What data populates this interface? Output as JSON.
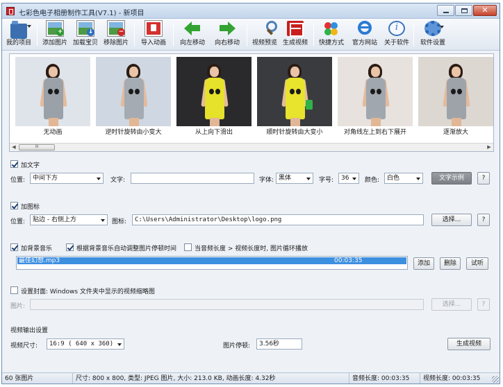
{
  "window": {
    "title": "七彩色电子相册制作工具(V7.1) - 新项目",
    "controls": [
      "minimize",
      "maximize",
      "close"
    ]
  },
  "toolbar": [
    {
      "id": "my-project",
      "label": "我的项目",
      "icon": "folder-icon"
    },
    {
      "id": "add-image",
      "label": "添加图片",
      "icon": "add-image-icon"
    },
    {
      "id": "load-saved",
      "label": "加载宝贝",
      "icon": "load-icon"
    },
    {
      "id": "remove-image",
      "label": "移除图片",
      "icon": "remove-image-icon"
    },
    {
      "id": "import-animation",
      "label": "导入动画",
      "icon": "import-icon"
    },
    {
      "id": "move-left",
      "label": "向左移动",
      "icon": "arrow-left-icon"
    },
    {
      "id": "move-right",
      "label": "向右移动",
      "icon": "arrow-right-icon"
    },
    {
      "id": "video-preview",
      "label": "视频预览",
      "icon": "magnifier-icon"
    },
    {
      "id": "generate-video",
      "label": "生成视频",
      "icon": "film-icon"
    },
    {
      "id": "shortcut",
      "label": "快捷方式",
      "icon": "shortcut-icon"
    },
    {
      "id": "website",
      "label": "官方网站",
      "icon": "browser-icon"
    },
    {
      "id": "about",
      "label": "关于软件",
      "icon": "info-icon"
    },
    {
      "id": "settings",
      "label": "软件设置",
      "icon": "gear-icon"
    }
  ],
  "thumbnails": [
    {
      "caption": "无动画",
      "scene": "gray-dress-white-room",
      "bg": "#dfe4ea",
      "dress": "#9aa1a9"
    },
    {
      "caption": "逆时针旋转由小变大",
      "scene": "gray-dress-window",
      "bg": "#cfd8e2",
      "dress": "#a4abb3"
    },
    {
      "caption": "从上向下滑出",
      "scene": "yellow-dress-car",
      "bg": "#2a2a2c",
      "dress": "#e6e12a"
    },
    {
      "caption": "顺时针旋转由大变小",
      "scene": "yellow-dress-car-bag",
      "bg": "#3a3b3f",
      "dress": "#e8e32c"
    },
    {
      "caption": "对角线左上到右下展开",
      "scene": "gray-dress-room",
      "bg": "#e7e2dd",
      "dress": "#a1a7ae"
    },
    {
      "caption": "逐渐放大",
      "scene": "gray-dress-closeup",
      "bg": "#ddd7d2",
      "dress": "#9ea3aa"
    }
  ],
  "text_section": {
    "enable_label": "加文字",
    "enabled": true,
    "position_label": "位置:",
    "position_value": "中间下方",
    "text_label": "文字:",
    "text_value": "",
    "font_label": "字体:",
    "font_value": "黑体",
    "size_label": "字号:",
    "size_value": "36",
    "color_label": "颜色:",
    "color_value": "白色",
    "sample_button": "文字示例",
    "help_button": "?"
  },
  "logo_section": {
    "enable_label": "加图标",
    "enabled": true,
    "position_label": "位置:",
    "position_value": "贴边 - 右侧上方",
    "icon_label": "图标:",
    "icon_path": "C:\\Users\\Administrator\\Desktop\\logo.png",
    "browse_button": "选择...",
    "help_button": "?"
  },
  "music_section": {
    "enable_label": "加背景音乐",
    "enabled": true,
    "auto_adjust_label": "根据背景音乐自动调整图片停顿时间",
    "auto_adjust": true,
    "loop_label": "当音频长度 > 视频长度时, 图片循环播放",
    "loop": false,
    "track_name": "最佳幻想.mp3",
    "track_duration": "00:03:35",
    "add_button": "添加",
    "delete_button": "删除",
    "listen_button": "试听"
  },
  "cover_section": {
    "enable_label": "设置封面: Windows 文件夹中显示的视频缩略图",
    "enabled": false,
    "image_label": "图片:",
    "image_value": "",
    "browse_button": "选择...",
    "help_button": "?"
  },
  "output_section": {
    "title": "视频输出设置",
    "size_label": "视频尺寸:",
    "size_value": "16:9 ( 640 x 360)",
    "pause_label": "图片停顿:",
    "pause_value": "3.56秒",
    "generate_button": "生成视频"
  },
  "statusbar": {
    "count": "60 张图片",
    "info": "尺寸: 800 x 800, 类型: JPEG 图片, 大小: 213.0 KB, 动画长度: 4.32秒",
    "audio_length": "音频长度: 00:03:35",
    "video_length": "视频长度: 00:03:35"
  },
  "colors": {
    "title_bar": "#c4d6ec",
    "selection": "#3d8fe0",
    "close_button": "#c6432d",
    "accent_green": "#33a333"
  }
}
